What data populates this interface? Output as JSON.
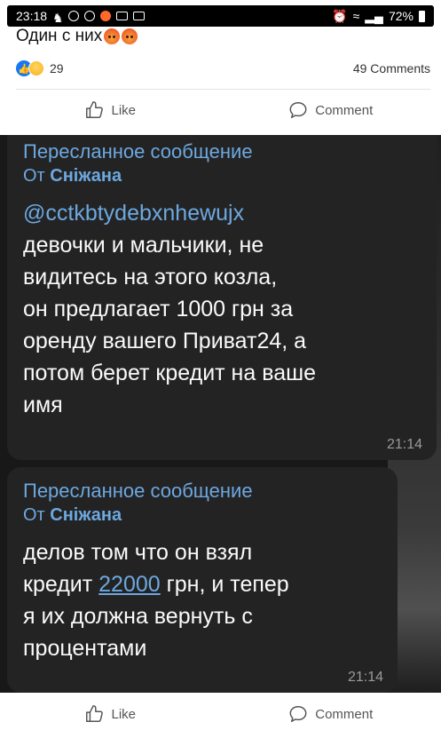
{
  "status_bar": {
    "time": "23:18",
    "battery": "72%"
  },
  "post": {
    "text": "Один с них",
    "reaction_count": "29",
    "comments": "49 Comments",
    "like_label": "Like",
    "comment_label": "Comment"
  },
  "messages": [
    {
      "forwarded_label": "Пересланное сообщение",
      "from_prefix": "От",
      "from_name": "Сніжана",
      "mention": "@cctkbtydebxnhewujx",
      "lines": [
        "девочки и мальчики, не",
        "видитесь на этого козла,",
        "он предлагает 1000 грн за",
        "оренду вашего Приват24, а",
        "потом берет кредит на ваше",
        "имя"
      ],
      "time": "21:14"
    },
    {
      "forwarded_label": "Пересланное сообщение",
      "from_prefix": "От",
      "from_name": "Сніжана",
      "line1": "делов том что он взял",
      "line2_prefix": "кредит",
      "line2_link": "22000",
      "line2_suffix": "грн, и тепер",
      "line3": "я их должна вернуть с",
      "line4": "процентами",
      "time": "21:14"
    }
  ],
  "colors": {
    "link_blue": "#6da8e0",
    "facebook_blue": "#1877f2",
    "bubble_bg": "#232323"
  }
}
